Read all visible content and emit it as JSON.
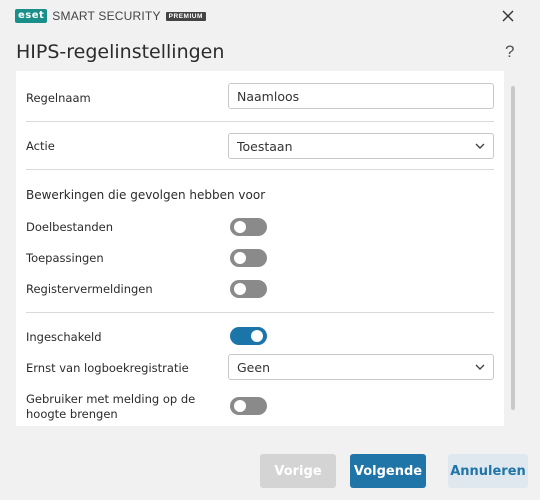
{
  "app": {
    "brand": "eset",
    "product": "SMART SECURITY",
    "edition": "PREMIUM"
  },
  "page": {
    "title": "HIPS-regelinstellingen",
    "help": "?"
  },
  "form": {
    "rule_name": {
      "label": "Regelnaam",
      "value": "Naamloos"
    },
    "action": {
      "label": "Actie",
      "value": "Toestaan"
    },
    "operations_heading": "Bewerkingen die gevolgen hebben voor",
    "target_files": {
      "label": "Doelbestanden",
      "enabled": false
    },
    "applications": {
      "label": "Toepassingen",
      "enabled": false
    },
    "registry_entries": {
      "label": "Registervermeldingen",
      "enabled": false
    },
    "enabled": {
      "label": "Ingeschakeld",
      "enabled": true
    },
    "log_severity": {
      "label": "Ernst van logboekregistratie",
      "value": "Geen"
    },
    "notify_user": {
      "label_line1": "Gebruiker met melding op de",
      "label_line2": "hoogte brengen",
      "enabled": false
    }
  },
  "buttons": {
    "previous": "Vorige",
    "next": "Volgende",
    "cancel": "Annuleren"
  },
  "colors": {
    "brand": "#1a8f8a",
    "accent": "#1f74a8",
    "toggle_off": "#8a8a8a"
  }
}
